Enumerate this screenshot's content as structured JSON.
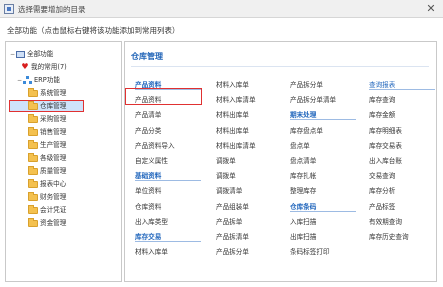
{
  "window": {
    "title": "选择需要增加的目录",
    "close_glyph": "✕"
  },
  "hint": "全部功能（点击鼠标右键将该功能添加到常用列表）",
  "tree": [
    {
      "label": "全部功能",
      "icon": "computer-icon",
      "toggle": "−"
    },
    {
      "label": "我的常用(7)",
      "icon": "heart-icon",
      "toggle": ""
    },
    {
      "label": "ERP功能",
      "icon": "org-chart-icon",
      "toggle": "−"
    },
    {
      "label": "系统管理",
      "icon": "folder-icon",
      "toggle": ""
    },
    {
      "label": "仓库管理",
      "icon": "folder-icon",
      "toggle": ""
    },
    {
      "label": "采购管理",
      "icon": "folder-icon",
      "toggle": ""
    },
    {
      "label": "销售管理",
      "icon": "folder-icon",
      "toggle": ""
    },
    {
      "label": "生产管理",
      "icon": "folder-icon",
      "toggle": ""
    },
    {
      "label": "各级管理",
      "icon": "folder-icon",
      "toggle": ""
    },
    {
      "label": "质量管理",
      "icon": "folder-icon",
      "toggle": ""
    },
    {
      "label": "报表中心",
      "icon": "folder-icon",
      "toggle": ""
    },
    {
      "label": "财务管理",
      "icon": "folder-icon",
      "toggle": ""
    },
    {
      "label": "会计凭证",
      "icon": "folder-icon",
      "toggle": ""
    },
    {
      "label": "资金管理",
      "icon": "folder-icon",
      "toggle": ""
    }
  ],
  "selected_tree_item": "仓库管理",
  "panel": {
    "title": "仓库管理",
    "columns": [
      [
        {
          "text": "产品资料",
          "kind": "heading"
        },
        {
          "text": "产品资料",
          "kind": "item"
        },
        {
          "text": "产品清单",
          "kind": "item"
        },
        {
          "text": "产品分类",
          "kind": "item"
        },
        {
          "text": "产品资料导入",
          "kind": "item"
        },
        {
          "text": "自定义属性",
          "kind": "item"
        },
        {
          "text": "基础资料",
          "kind": "heading"
        },
        {
          "text": "单位资料",
          "kind": "item"
        },
        {
          "text": "仓库资料",
          "kind": "item"
        },
        {
          "text": "出入库类型",
          "kind": "item"
        },
        {
          "text": "库存交易",
          "kind": "heading"
        },
        {
          "text": "材料入库单",
          "kind": "item"
        }
      ],
      [
        {
          "text": "材料入库单",
          "kind": "item"
        },
        {
          "text": "材料入库清单",
          "kind": "item"
        },
        {
          "text": "材料出库单",
          "kind": "item"
        },
        {
          "text": "材料出库单",
          "kind": "item"
        },
        {
          "text": "材料出库清单",
          "kind": "item"
        },
        {
          "text": "调拨单",
          "kind": "item"
        },
        {
          "text": "调拨单",
          "kind": "item"
        },
        {
          "text": "调拨清单",
          "kind": "item"
        },
        {
          "text": "产品组装单",
          "kind": "item"
        },
        {
          "text": "产品拆单",
          "kind": "item"
        },
        {
          "text": "产品拆清单",
          "kind": "item"
        },
        {
          "text": "产品拆分单",
          "kind": "item"
        }
      ],
      [
        {
          "text": "产品拆分单",
          "kind": "item"
        },
        {
          "text": "产品拆分单清单",
          "kind": "item"
        },
        {
          "text": "期末处理",
          "kind": "heading"
        },
        {
          "text": "库存盘点单",
          "kind": "item"
        },
        {
          "text": "盘点单",
          "kind": "item"
        },
        {
          "text": "盘点清单",
          "kind": "item"
        },
        {
          "text": "库存扎帐",
          "kind": "item"
        },
        {
          "text": "整理库存",
          "kind": "item"
        },
        {
          "text": "仓库条码",
          "kind": "heading"
        },
        {
          "text": "入库扫描",
          "kind": "item"
        },
        {
          "text": "出库扫描",
          "kind": "item"
        },
        {
          "text": "条码标签打印",
          "kind": "item"
        }
      ],
      [
        {
          "text": "查询报表",
          "kind": "heading-u"
        },
        {
          "text": "库存查询",
          "kind": "item"
        },
        {
          "text": "库存金额",
          "kind": "item"
        },
        {
          "text": "库存明细表",
          "kind": "item"
        },
        {
          "text": "库存交易表",
          "kind": "item"
        },
        {
          "text": "出入库台账",
          "kind": "item"
        },
        {
          "text": "交易查询",
          "kind": "item"
        },
        {
          "text": "库存分析",
          "kind": "item"
        },
        {
          "text": "产品标签",
          "kind": "item"
        },
        {
          "text": "有效期查询",
          "kind": "item"
        },
        {
          "text": "库存历史查询",
          "kind": "item"
        }
      ]
    ]
  }
}
